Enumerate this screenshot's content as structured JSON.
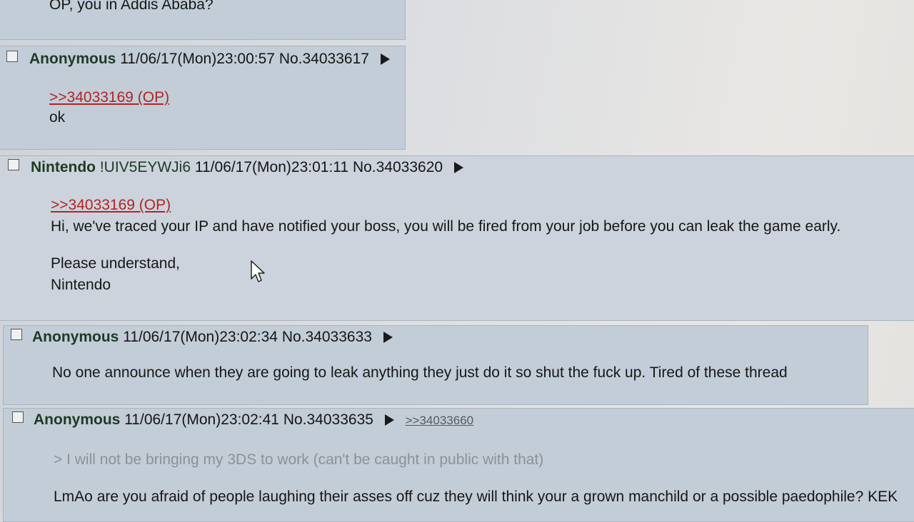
{
  "posts": [
    {
      "id": "prev",
      "body_lines": [
        "OP, you in Addis Ababa?"
      ]
    },
    {
      "id": "p1",
      "name": "Anonymous",
      "datetime": "11/06/17(Mon)23:00:57",
      "no": "No.34033617",
      "quote": ">>34033169 (OP)",
      "body_lines": [
        "ok"
      ]
    },
    {
      "id": "p2",
      "name": "Nintendo",
      "tripcode": "!UIV5EYWJi6",
      "datetime": "11/06/17(Mon)23:01:11",
      "no": "No.34033620",
      "quote": ">>34033169 (OP)",
      "body_lines": [
        "Hi, we've traced your IP and have notified your boss, you will be fired from your job before you can leak the game early.",
        "Please understand,",
        "Nintendo"
      ]
    },
    {
      "id": "p3",
      "name": "Anonymous",
      "datetime": "11/06/17(Mon)23:02:34",
      "no": "No.34033633",
      "body_lines": [
        "No one announce when they are going to leak anything they just do it so shut the fuck up. Tired of these thread"
      ]
    },
    {
      "id": "p4",
      "name": "Anonymous",
      "datetime": "11/06/17(Mon)23:02:41",
      "no": "No.34033635",
      "backlink": ">>34033660",
      "greentext": "> I will not be bringing my 3DS to work (can't be caught in public with that)",
      "body_lines": [
        "LmAo are you afraid of people laughing their asses off cuz they will think your a grown manchild or a possible paedophile? KEK"
      ]
    }
  ],
  "icons": {
    "post_menu": "triangle-right-icon",
    "pointer": "mouse-cursor-icon",
    "select": "checkbox-icon"
  }
}
